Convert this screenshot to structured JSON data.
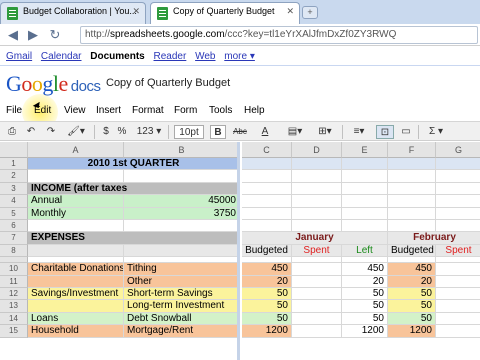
{
  "browser": {
    "tabs": [
      {
        "label": "Budget Collaboration | You..."
      },
      {
        "label": "Copy of Quarterly Budget"
      }
    ],
    "new_tab": "+",
    "url_prefix": "http://",
    "url_host": "spreadsheets.google.com",
    "url_path": "/ccc?key=tl1eYrXAlJfmDxZf0ZY3RWQ"
  },
  "google_bar": {
    "items": [
      "Gmail",
      "Calendar",
      "Documents",
      "Reader",
      "Web",
      "more ▾"
    ],
    "active": "Documents"
  },
  "docs": {
    "logo_letters": [
      "G",
      "o",
      "o",
      "g",
      "l",
      "e"
    ],
    "logo_suffix": "docs",
    "title": "Copy of Quarterly Budget"
  },
  "menu": [
    "File",
    "Edit",
    "View",
    "Insert",
    "Format",
    "Form",
    "Tools",
    "Help"
  ],
  "toolbar": {
    "currency": "$",
    "percent": "%",
    "number_format": "123 ▾",
    "font_size": "10pt ▾",
    "bold": "B",
    "strike": "Abc",
    "text_color": "A",
    "sum": "Σ ▾"
  },
  "columns": [
    "",
    "A",
    "B",
    "C",
    "D",
    "E",
    "F",
    "G"
  ],
  "rows": [
    {
      "n": "1",
      "cells": [
        "2010 1st QUARTER",
        "",
        "",
        "",
        "",
        "",
        ""
      ]
    },
    {
      "n": "2",
      "cells": [
        "",
        "",
        "",
        "",
        "",
        "",
        ""
      ]
    },
    {
      "n": "3",
      "cells": [
        "INCOME (after taxes",
        "",
        "",
        "",
        "",
        "",
        ""
      ]
    },
    {
      "n": "4",
      "cells": [
        "Annual",
        "45000",
        "",
        "",
        "",
        "",
        ""
      ]
    },
    {
      "n": "5",
      "cells": [
        "Monthly",
        "3750",
        "",
        "",
        "",
        "",
        ""
      ]
    },
    {
      "n": "6",
      "cells": [
        "",
        "",
        "",
        "",
        "",
        "",
        ""
      ]
    },
    {
      "n": "7",
      "cells": [
        "EXPENSES",
        "",
        "",
        "January",
        "",
        "",
        "February"
      ]
    },
    {
      "n": "8",
      "cells": [
        "",
        "",
        "Budgeted",
        "Spent",
        "Left",
        "Budgeted",
        "Spent"
      ]
    },
    {
      "n": "9",
      "cells": [
        "",
        "",
        "",
        "",
        "",
        "",
        ""
      ]
    },
    {
      "n": "10",
      "cells": [
        "Charitable Donations",
        "Tithing",
        "450",
        "",
        "450",
        "450",
        ""
      ]
    },
    {
      "n": "11",
      "cells": [
        "",
        "Other",
        "20",
        "",
        "20",
        "20",
        ""
      ]
    },
    {
      "n": "12",
      "cells": [
        "Savings/Investment",
        "Short-term Savings",
        "50",
        "",
        "50",
        "50",
        ""
      ]
    },
    {
      "n": "13",
      "cells": [
        "",
        "Long-term Investment",
        "50",
        "",
        "50",
        "50",
        ""
      ]
    },
    {
      "n": "14",
      "cells": [
        "Loans",
        "Debt Snowball",
        "50",
        "",
        "50",
        "50",
        ""
      ]
    },
    {
      "n": "15",
      "cells": [
        "Household",
        "Mortgage/Rent",
        "1200",
        "",
        "1200",
        "1200",
        ""
      ]
    }
  ],
  "colors": {
    "header_blue": "#a8c0e8",
    "income_gray": "#bdbdbd",
    "income_green": "#c9f0c9",
    "orange": "#f8c49a",
    "yellow": "#fbf39c",
    "light_green": "#d3f2c8",
    "spent_red": "#e02020",
    "left_green": "#1a8a1a",
    "january_red": "#7a1a1a"
  }
}
